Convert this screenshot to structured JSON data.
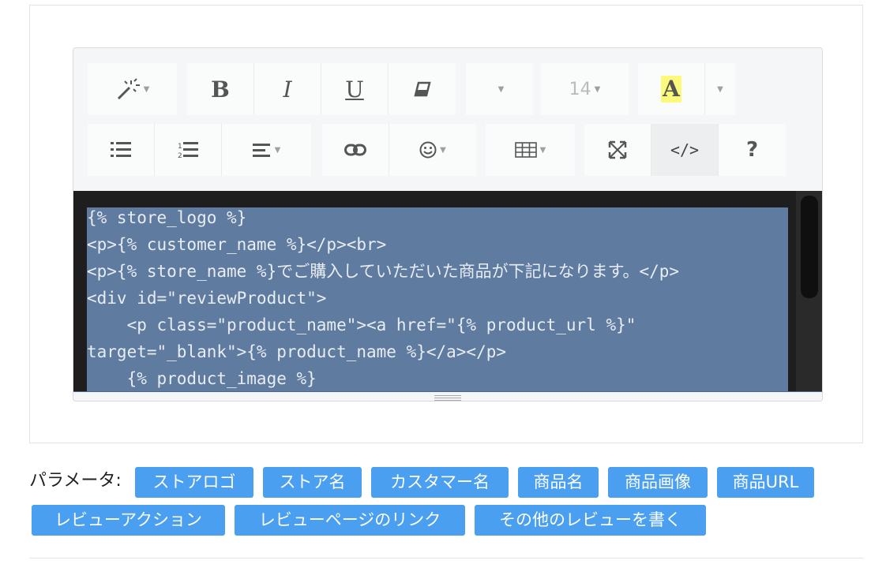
{
  "toolbar": {
    "row1": [
      {
        "name": "magic-style-button",
        "icon": "magic-wand-icon",
        "has_caret": true
      },
      {
        "name": "bold-button",
        "label": "B"
      },
      {
        "name": "italic-button",
        "label": "I"
      },
      {
        "name": "underline-button",
        "label": "U"
      },
      {
        "name": "clear-format-button",
        "icon": "eraser-icon"
      },
      {
        "name": "font-name-button",
        "has_caret": true
      },
      {
        "name": "font-size-button",
        "label": "14",
        "has_caret": true
      },
      {
        "name": "text-color-button",
        "label": "A",
        "highlight": "#fdf97a"
      },
      {
        "name": "color-dropdown-button",
        "has_caret": true
      }
    ],
    "row2": [
      {
        "name": "unordered-list-button",
        "icon": "unordered-list-icon"
      },
      {
        "name": "ordered-list-button",
        "icon": "ordered-list-icon"
      },
      {
        "name": "paragraph-align-button",
        "icon": "align-left-icon",
        "has_caret": true
      },
      {
        "name": "link-button",
        "icon": "link-icon"
      },
      {
        "name": "emoji-button",
        "icon": "smiley-icon",
        "has_caret": true
      },
      {
        "name": "table-button",
        "icon": "table-icon",
        "has_caret": true
      },
      {
        "name": "fullscreen-button",
        "icon": "fullscreen-icon"
      },
      {
        "name": "code-view-button",
        "label": "</>",
        "active": true
      },
      {
        "name": "help-button",
        "label": "?"
      }
    ]
  },
  "code_lines": [
    "{% store_logo %}",
    "<p>{% customer_name %}</p><br>",
    "<p>{% store_name %}でご購入していただいた商品が下記になります。</p>",
    "<div id=\"reviewProduct\">",
    "    <p class=\"product_name\"><a href=\"{% product_url %}\"",
    "target=\"_blank\">{% product_name %}</a></p>",
    "    {% product_image %}"
  ],
  "params": {
    "label": "パラメータ:",
    "tags": [
      "ストアロゴ",
      "ストア名",
      "カスタマー名",
      "商品名",
      "商品画像",
      "商品URL",
      "レビューアクション",
      "レビューページのリンク",
      "その他のレビューを書く"
    ]
  },
  "colors": {
    "tag_bg": "#4a9ff0",
    "code_bg": "#1e1e1e",
    "selection": "#5f7ba0"
  }
}
